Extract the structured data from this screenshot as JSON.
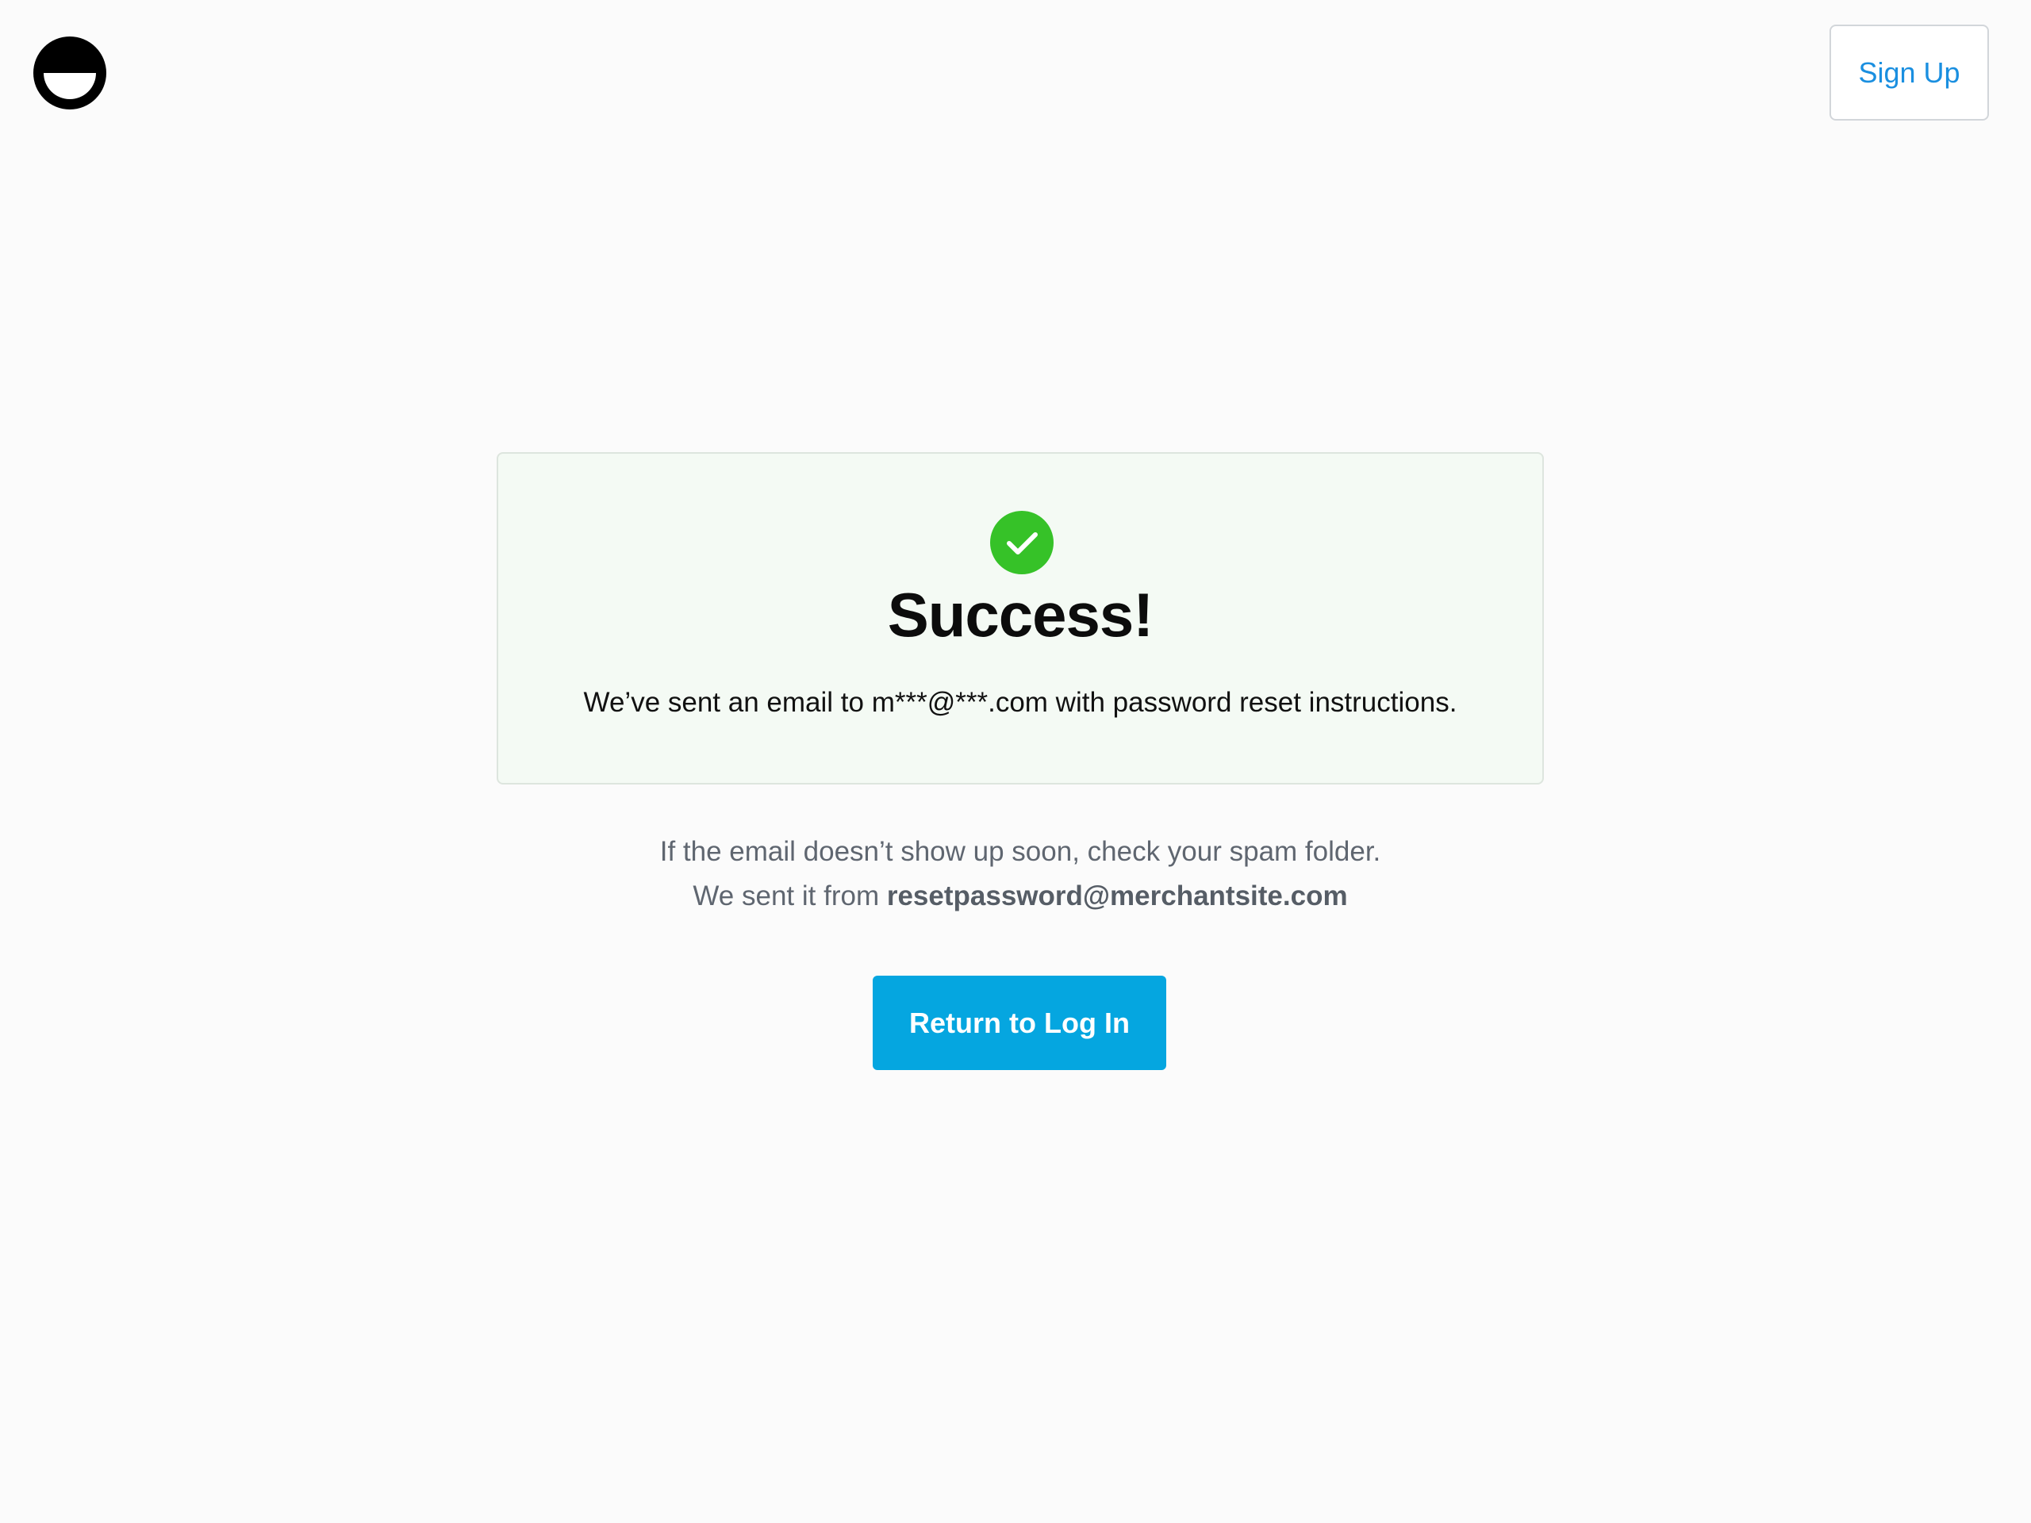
{
  "header": {
    "logo_icon": "half-smile-circle-logo",
    "signup_label": "Sign Up"
  },
  "card": {
    "icon": "check-circle-icon",
    "title": "Success!",
    "message": "We’ve sent an email to m***@***.com with password reset instructions."
  },
  "note": {
    "line1": "If the email doesn’t show up soon, check your spam folder.",
    "line2_prefix": "We sent it from",
    "sender_email": "resetpassword@merchantsite.com"
  },
  "actions": {
    "return_label": "Return to Log In"
  },
  "colors": {
    "page_background": "#fbfbfb",
    "card_background": "#f4faf4",
    "success_green": "#36c228",
    "primary_button": "#05a6e0",
    "link_blue": "#1a8fe0",
    "muted_text": "#5f6670"
  }
}
